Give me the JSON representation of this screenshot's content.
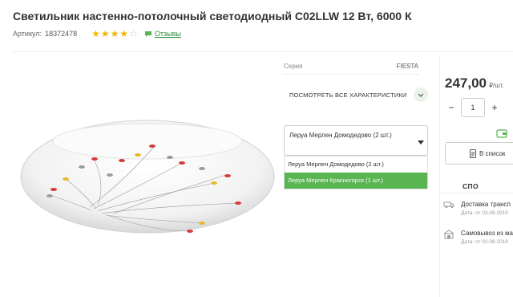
{
  "product": {
    "title": "Светильник настенно-потолочный светодиодный C02LLW 12 Вт, 6000 К",
    "article_label": "Артикул:",
    "article_value": "18372478",
    "rating": 4,
    "rating_max": 5,
    "reviews_label": "Отзывы"
  },
  "specs": {
    "series_label": "Серия",
    "series_value": "FIESTA",
    "all_specs_label": "ПОСМОТРЕТЬ ВСЕ ХАРАКТЕРИСТИКИ"
  },
  "store_select": {
    "selected": "Леруа Мерлен Домодедово (2 шт.)",
    "options": [
      "Леруа Мерлен Домодедово (2 шт.)",
      "Леруа Мерлен Красногорск (1 шт.)"
    ],
    "highlighted_index": 1
  },
  "buy": {
    "price": "247,00",
    "unit": "₽/шт.",
    "minus": "−",
    "quantity": "1",
    "plus": "+",
    "to_list_label": "В список"
  },
  "delivery": {
    "heading": "СПО",
    "rows": [
      {
        "title": "Доставка трансп",
        "date": "Дата: от 03.08.2019"
      },
      {
        "title": "Самовывоз из ма",
        "date": "Дата: от 02.08.2019"
      }
    ]
  },
  "colors": {
    "accent_green": "#58b552",
    "link_green": "#2f8a3d",
    "star_yellow": "#f4b400"
  }
}
